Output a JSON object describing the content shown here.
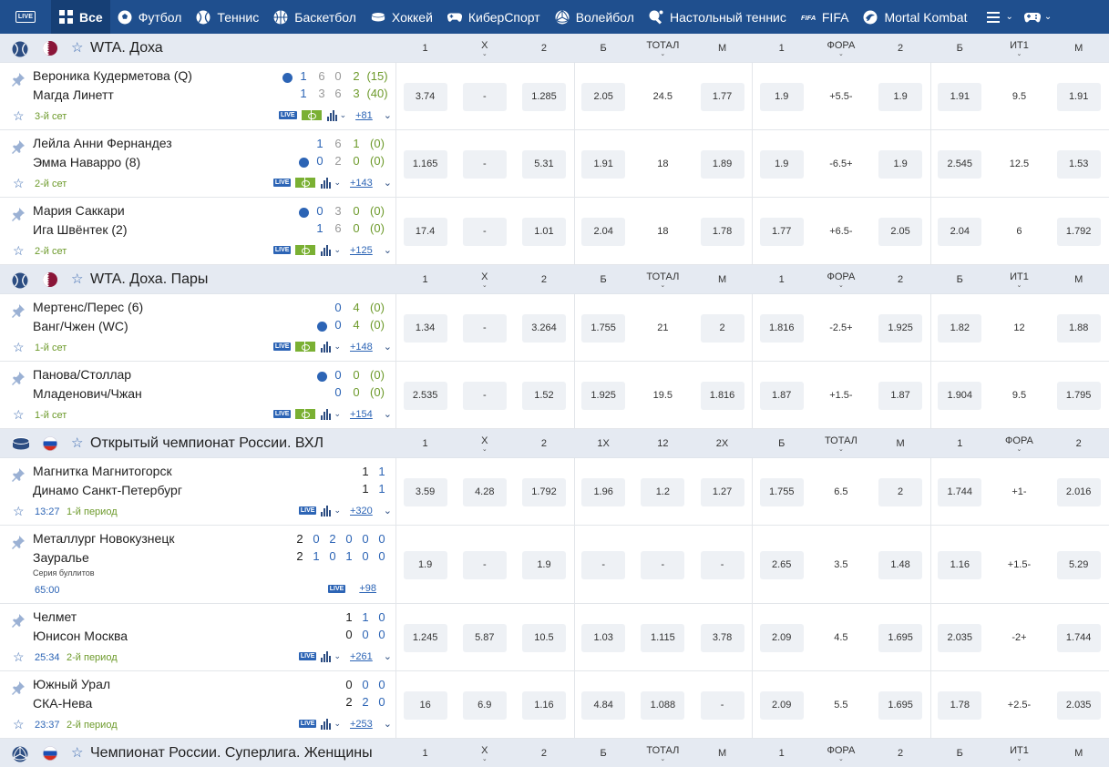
{
  "nav": {
    "live_label": "LIVE",
    "items": [
      {
        "label": "Все",
        "icon": "grid-icon"
      },
      {
        "label": "Футбол",
        "icon": "football-icon"
      },
      {
        "label": "Теннис",
        "icon": "tennis-icon"
      },
      {
        "label": "Баскетбол",
        "icon": "basketball-icon"
      },
      {
        "label": "Хоккей",
        "icon": "hockey-icon"
      },
      {
        "label": "КиберСпорт",
        "icon": "gamepad-icon"
      },
      {
        "label": "Волейбол",
        "icon": "volleyball-icon"
      },
      {
        "label": "Настольный теннис",
        "icon": "table-tennis-icon"
      },
      {
        "label": "FIFA",
        "icon": "fifa-icon"
      },
      {
        "label": "Mortal Kombat",
        "icon": "mortal-kombat-icon"
      }
    ]
  },
  "sections": [
    {
      "title": "WTA. Доха",
      "sport_icon": "tennis-icon",
      "flag": "qatar-flag",
      "columns": [
        "1",
        "X",
        "2",
        "Б",
        "ТОТАЛ",
        "М",
        "1",
        "ФОРА",
        "2",
        "Б",
        "ИТ1",
        "М"
      ],
      "chev_cols": [
        1,
        4,
        7,
        10
      ],
      "matches": [
        {
          "team1": "Вероника Кудерметова (Q)",
          "team2": "Магда Линетт",
          "serve": 1,
          "s1": [
            {
              "v": "1",
              "c": "blue"
            },
            {
              "v": "6",
              "c": "gray"
            },
            {
              "v": "0",
              "c": "gray"
            },
            {
              "v": "2",
              "c": "green"
            },
            {
              "v": "(15)",
              "c": "green"
            }
          ],
          "s2": [
            {
              "v": "1",
              "c": "blue"
            },
            {
              "v": "3",
              "c": "gray"
            },
            {
              "v": "6",
              "c": "gray"
            },
            {
              "v": "3",
              "c": "green"
            },
            {
              "v": "(40)",
              "c": "green"
            }
          ],
          "period": "3-й сет",
          "time": "",
          "field": true,
          "more": "+81",
          "odds": [
            "3.74",
            "-",
            "1.285",
            "2.05",
            "24.5",
            "1.77",
            "1.9",
            "+5.5-",
            "1.9",
            "1.91",
            "9.5",
            "1.91"
          ]
        },
        {
          "team1": "Лейла Анни Фернандез",
          "team2": "Эмма Наварро (8)",
          "serve": 2,
          "s1": [
            {
              "v": "1",
              "c": "blue"
            },
            {
              "v": "6",
              "c": "gray"
            },
            {
              "v": "1",
              "c": "green"
            },
            {
              "v": "(0)",
              "c": "green"
            }
          ],
          "s2": [
            {
              "v": "0",
              "c": "blue"
            },
            {
              "v": "2",
              "c": "gray"
            },
            {
              "v": "0",
              "c": "green"
            },
            {
              "v": "(0)",
              "c": "green"
            }
          ],
          "period": "2-й сет",
          "time": "",
          "field": true,
          "more": "+143",
          "odds": [
            "1.165",
            "-",
            "5.31",
            "1.91",
            "18",
            "1.89",
            "1.9",
            "-6.5+",
            "1.9",
            "2.545",
            "12.5",
            "1.53"
          ]
        },
        {
          "team1": "Мария Саккари",
          "team2": "Ига Швёнтек (2)",
          "serve": 1,
          "s1": [
            {
              "v": "0",
              "c": "blue"
            },
            {
              "v": "3",
              "c": "gray"
            },
            {
              "v": "0",
              "c": "green"
            },
            {
              "v": "(0)",
              "c": "green"
            }
          ],
          "s2": [
            {
              "v": "1",
              "c": "blue"
            },
            {
              "v": "6",
              "c": "gray"
            },
            {
              "v": "0",
              "c": "green"
            },
            {
              "v": "(0)",
              "c": "green"
            }
          ],
          "period": "2-й сет",
          "time": "",
          "field": true,
          "more": "+125",
          "odds": [
            "17.4",
            "-",
            "1.01",
            "2.04",
            "18",
            "1.78",
            "1.77",
            "+6.5-",
            "2.05",
            "2.04",
            "6",
            "1.792"
          ]
        }
      ]
    },
    {
      "title": "WTA. Доха. Пары",
      "sport_icon": "tennis-icon",
      "flag": "qatar-flag",
      "columns": [
        "1",
        "X",
        "2",
        "Б",
        "ТОТАЛ",
        "М",
        "1",
        "ФОРА",
        "2",
        "Б",
        "ИТ1",
        "М"
      ],
      "chev_cols": [
        1,
        4,
        7,
        10
      ],
      "matches": [
        {
          "team1": "Мертенс/Перес (6)",
          "team2": "Ванг/Чжен (WC)",
          "serve": 2,
          "s1": [
            {
              "v": "0",
              "c": "blue"
            },
            {
              "v": "4",
              "c": "green"
            },
            {
              "v": "(0)",
              "c": "green"
            }
          ],
          "s2": [
            {
              "v": "0",
              "c": "blue"
            },
            {
              "v": "4",
              "c": "green"
            },
            {
              "v": "(0)",
              "c": "green"
            }
          ],
          "period": "1-й сет",
          "time": "",
          "field": true,
          "more": "+148",
          "odds": [
            "1.34",
            "-",
            "3.264",
            "1.755",
            "21",
            "2",
            "1.816",
            "-2.5+",
            "1.925",
            "1.82",
            "12",
            "1.88"
          ]
        },
        {
          "team1": "Панова/Столлар",
          "team2": "Младенович/Чжан",
          "serve": 1,
          "s1": [
            {
              "v": "0",
              "c": "blue"
            },
            {
              "v": "0",
              "c": "green"
            },
            {
              "v": "(0)",
              "c": "green"
            }
          ],
          "s2": [
            {
              "v": "0",
              "c": "blue"
            },
            {
              "v": "0",
              "c": "green"
            },
            {
              "v": "(0)",
              "c": "green"
            }
          ],
          "period": "1-й сет",
          "time": "",
          "field": true,
          "more": "+154",
          "odds": [
            "2.535",
            "-",
            "1.52",
            "1.925",
            "19.5",
            "1.816",
            "1.87",
            "+1.5-",
            "1.87",
            "1.904",
            "9.5",
            "1.795"
          ]
        }
      ]
    },
    {
      "title": "Открытый чемпионат России. ВХЛ",
      "sport_icon": "hockey-icon",
      "flag": "russia-flag",
      "columns": [
        "1",
        "X",
        "2",
        "1X",
        "12",
        "2X",
        "Б",
        "ТОТАЛ",
        "М",
        "1",
        "ФОРА",
        "2"
      ],
      "chev_cols": [
        1,
        7,
        10
      ],
      "matches": [
        {
          "team1": "Магнитка Магнитогорск",
          "team2": "Динамо Санкт-Петербург",
          "serve": 0,
          "s1": [
            {
              "v": "1",
              "c": "dark"
            },
            {
              "v": "1",
              "c": "blue"
            }
          ],
          "s2": [
            {
              "v": "1",
              "c": "dark"
            },
            {
              "v": "1",
              "c": "blue"
            }
          ],
          "period": "1-й период",
          "time": "13:27",
          "field": false,
          "more": "+320",
          "odds": [
            "3.59",
            "4.28",
            "1.792",
            "1.96",
            "1.2",
            "1.27",
            "1.755",
            "6.5",
            "2",
            "1.744",
            "+1-",
            "2.016"
          ]
        },
        {
          "team1": "Металлург Новокузнецк",
          "team2": "Зауралье",
          "serve": 0,
          "note": "Серия буллитов",
          "s1": [
            {
              "v": "2",
              "c": "dark"
            },
            {
              "v": "0",
              "c": "blue"
            },
            {
              "v": "2",
              "c": "blue"
            },
            {
              "v": "0",
              "c": "blue"
            },
            {
              "v": "0",
              "c": "blue"
            },
            {
              "v": "0",
              "c": "blue"
            }
          ],
          "s2": [
            {
              "v": "2",
              "c": "dark"
            },
            {
              "v": "1",
              "c": "blue"
            },
            {
              "v": "0",
              "c": "blue"
            },
            {
              "v": "1",
              "c": "blue"
            },
            {
              "v": "0",
              "c": "blue"
            },
            {
              "v": "0",
              "c": "blue"
            }
          ],
          "period": "",
          "time": "65:00",
          "field": false,
          "more": "+98",
          "nostar": true,
          "odds": [
            "1.9",
            "-",
            "1.9",
            "-",
            "-",
            "-",
            "2.65",
            "3.5",
            "1.48",
            "1.16",
            "+1.5-",
            "5.29"
          ]
        },
        {
          "team1": "Челмет",
          "team2": "Юнисон Москва",
          "serve": 0,
          "s1": [
            {
              "v": "1",
              "c": "dark"
            },
            {
              "v": "1",
              "c": "blue"
            },
            {
              "v": "0",
              "c": "blue"
            }
          ],
          "s2": [
            {
              "v": "0",
              "c": "dark"
            },
            {
              "v": "0",
              "c": "blue"
            },
            {
              "v": "0",
              "c": "blue"
            }
          ],
          "period": "2-й период",
          "time": "25:34",
          "field": false,
          "more": "+261",
          "odds": [
            "1.245",
            "5.87",
            "10.5",
            "1.03",
            "1.115",
            "3.78",
            "2.09",
            "4.5",
            "1.695",
            "2.035",
            "-2+",
            "1.744"
          ]
        },
        {
          "team1": "Южный Урал",
          "team2": "СКА-Нева",
          "serve": 0,
          "s1": [
            {
              "v": "0",
              "c": "dark"
            },
            {
              "v": "0",
              "c": "blue"
            },
            {
              "v": "0",
              "c": "blue"
            }
          ],
          "s2": [
            {
              "v": "2",
              "c": "dark"
            },
            {
              "v": "2",
              "c": "blue"
            },
            {
              "v": "0",
              "c": "blue"
            }
          ],
          "period": "2-й период",
          "time": "23:37",
          "field": false,
          "more": "+253",
          "odds": [
            "16",
            "6.9",
            "1.16",
            "4.84",
            "1.088",
            "-",
            "2.09",
            "5.5",
            "1.695",
            "1.78",
            "+2.5-",
            "2.035"
          ]
        }
      ]
    },
    {
      "title": "Чемпионат России. Суперлига. Женщины",
      "sport_icon": "volleyball-icon",
      "flag": "russia-flag",
      "columns": [
        "1",
        "X",
        "2",
        "Б",
        "ТОТАЛ",
        "М",
        "1",
        "ФОРА",
        "2",
        "Б",
        "ИТ1",
        "М"
      ],
      "chev_cols": [
        1,
        4,
        7,
        10
      ],
      "matches": []
    }
  ],
  "colors": {
    "nav_bg": "#1f4f8e",
    "header_bg": "#e5eaf2",
    "accent": "#2c64b5",
    "green": "#6d9a2b",
    "odd_bg": "#eef1f5"
  }
}
